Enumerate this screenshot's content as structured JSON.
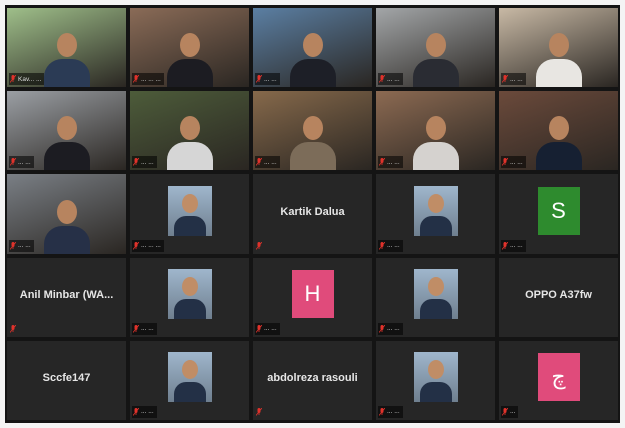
{
  "meeting": {
    "tiles": [
      {
        "kind": "video",
        "name": "Kav... ...",
        "scene": "#9fbf8a",
        "body": "#2b3b55"
      },
      {
        "kind": "video",
        "name": "... ... ...",
        "scene": "#8a6b57",
        "body": "#1c1c22"
      },
      {
        "kind": "video",
        "name": "... ...",
        "scene": "#5b7fa3",
        "body": "#1d1f27"
      },
      {
        "kind": "video",
        "name": "... ...",
        "scene": "#a3a6a8",
        "body": "#2a2c33"
      },
      {
        "kind": "video",
        "name": "... ...",
        "scene": "#c8b9a5",
        "body": "#e8e6e2"
      },
      {
        "kind": "video",
        "name": "... ...",
        "scene": "#9b9fa4",
        "body": "#1c1c22"
      },
      {
        "kind": "video",
        "name": "... ...",
        "scene": "#4d5c3a",
        "body": "#d6d6d6"
      },
      {
        "kind": "video",
        "name": "... ...",
        "scene": "#86694b",
        "body": "#7c6c59"
      },
      {
        "kind": "video",
        "name": "... ...",
        "scene": "#8c6a52",
        "body": "#d5d2cf"
      },
      {
        "kind": "video",
        "name": "... ...",
        "scene": "#6b4a3b",
        "body": "#162032"
      },
      {
        "kind": "video",
        "name": "... ...",
        "scene": "#7a7f85",
        "body": "#263047"
      },
      {
        "kind": "thumb",
        "name": "... ... ..."
      },
      {
        "kind": "text",
        "name": "",
        "center": "Kartik Dalua",
        "muted": true
      },
      {
        "kind": "thumb",
        "name": "... ..."
      },
      {
        "kind": "avatar",
        "name": "... ...",
        "initial": "S",
        "color": "#2e8b2e"
      },
      {
        "kind": "text",
        "name": "",
        "center": "Anil Minbar (WA...",
        "muted": true
      },
      {
        "kind": "thumb",
        "name": "... ..."
      },
      {
        "kind": "avatar",
        "name": "... ...",
        "initial": "H",
        "color": "#e04b7b"
      },
      {
        "kind": "thumb",
        "name": "... ..."
      },
      {
        "kind": "text",
        "name": "",
        "center": "OPPO A37fw",
        "muted": false
      },
      {
        "kind": "text",
        "name": "",
        "center": "Sccfe147",
        "muted": false
      },
      {
        "kind": "thumb",
        "name": "... ..."
      },
      {
        "kind": "text",
        "name": "",
        "center": "abdolreza rasouli",
        "muted": true
      },
      {
        "kind": "thumb",
        "name": "... ..."
      },
      {
        "kind": "avatar",
        "name": "...",
        "initial": "چ",
        "color": "#e04b7b"
      }
    ],
    "icons": {
      "mic_muted": "mic-muted-icon"
    },
    "colors": {
      "mic_muted": "#e0322b",
      "tile_bg": "#262626",
      "frame_bg": "#141414"
    }
  }
}
